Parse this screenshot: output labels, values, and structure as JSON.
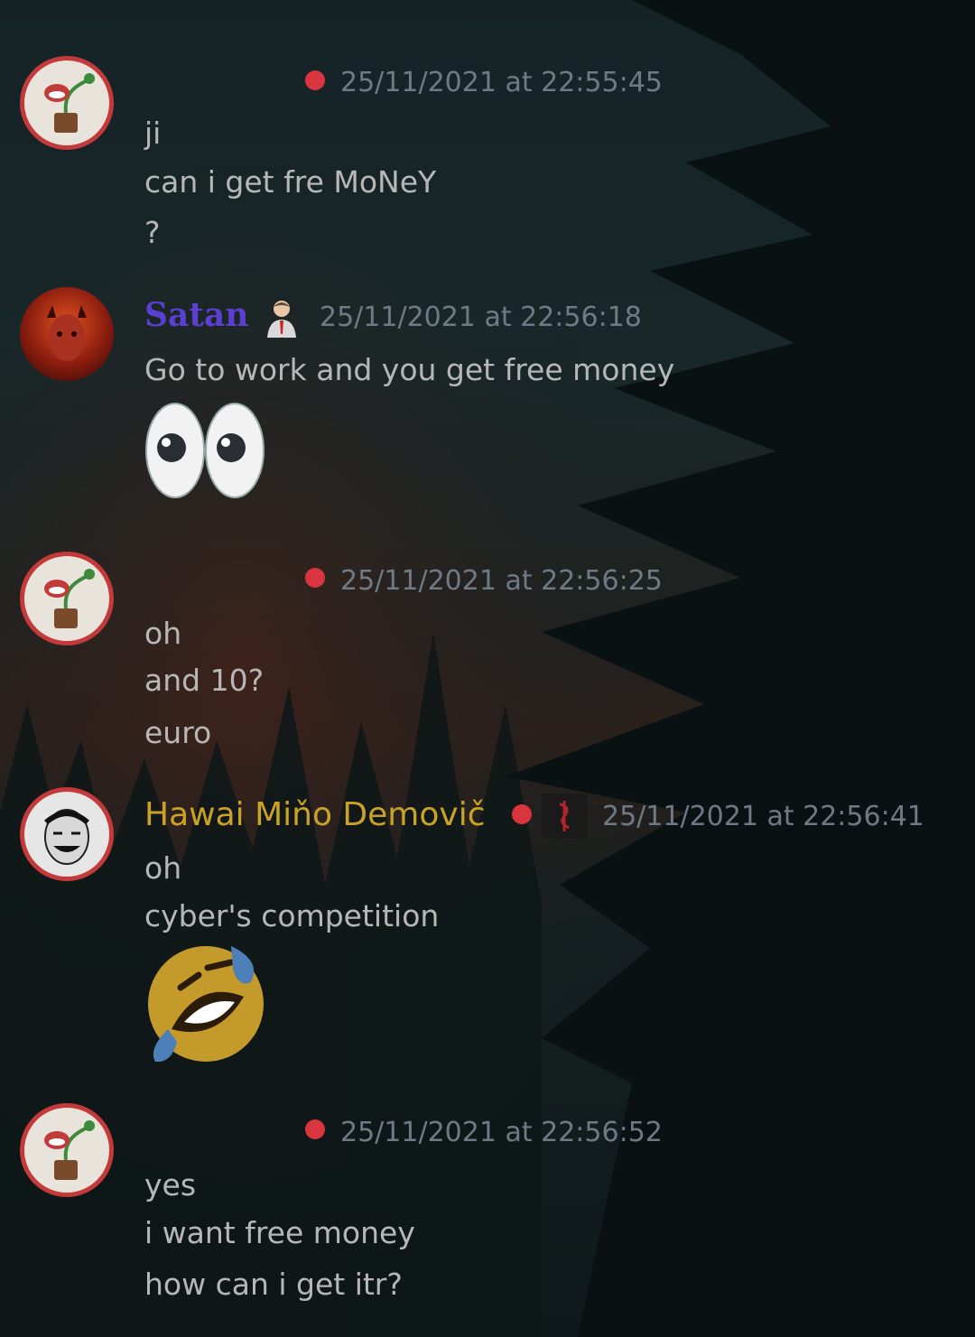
{
  "messages": [
    {
      "author": "",
      "timestamp": "25/11/2021 at 22:55:45",
      "lines": [
        "ji",
        "can i get fre MoNeY",
        "?"
      ]
    },
    {
      "author": "Satan",
      "author_color": "#5b3fd1",
      "badge_icon": "businessman-icon",
      "timestamp": "25/11/2021 at 22:56:18",
      "lines": [
        "Go to work and you get free money"
      ],
      "emoji": "eyes-emoji"
    },
    {
      "author": "",
      "timestamp": "25/11/2021 at 22:56:25",
      "lines": [
        "oh",
        "and 10?",
        "euro"
      ]
    },
    {
      "author": "Hawai Miňo Demovič",
      "author_color": "#c9a227",
      "badge_icon": "slipknot-logo-icon",
      "timestamp": "25/11/2021 at 22:56:41",
      "lines": [
        "oh",
        "cyber's competition"
      ],
      "emoji": "rofl-emoji"
    },
    {
      "author": "",
      "timestamp": "25/11/2021 at 22:56:52",
      "lines": [
        "yes",
        "i want free money",
        "how can i get itr?"
      ]
    }
  ],
  "colors": {
    "status_dot": "#d9353f",
    "timestamp": "#6f7a86",
    "message_text": "#b7b7b7",
    "avatar_ring": "#c43a3a"
  }
}
